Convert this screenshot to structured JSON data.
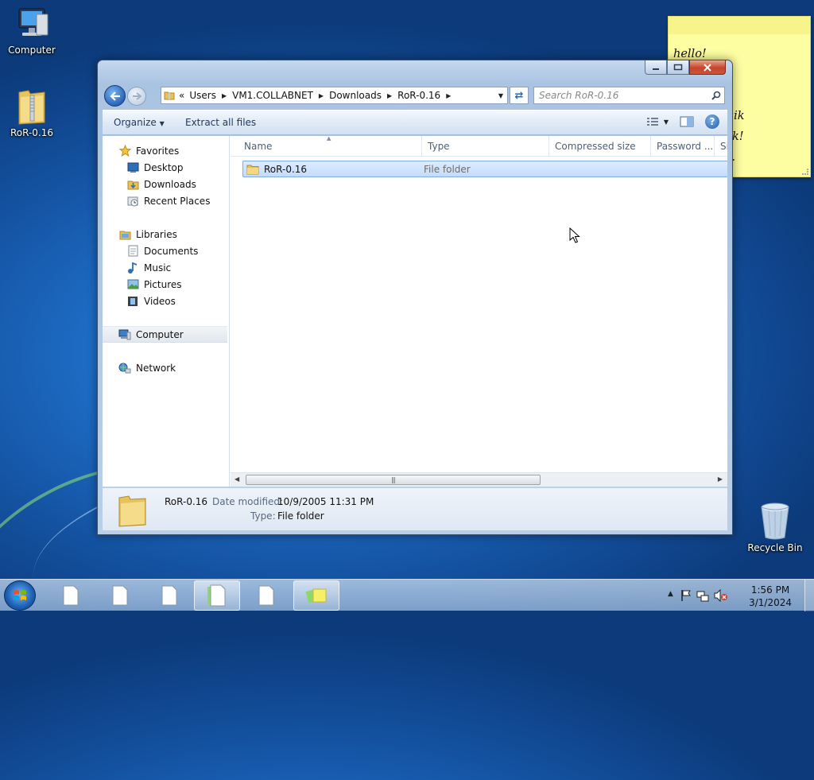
{
  "desktop": {
    "icons": [
      {
        "label": "Computer"
      },
      {
        "label": "RoR-0.16"
      },
      {
        "label": "Recycle Bin"
      }
    ],
    "sticky_note": {
      "text": "hello!\n destroyed\n out the\n works, afaik\n ed anydesk!\n nstalled it."
    }
  },
  "window": {
    "address": {
      "overflow": "«",
      "crumbs": [
        "Users",
        "VM1.COLLABNET",
        "Downloads",
        "RoR-0.16"
      ]
    },
    "search": {
      "placeholder": "Search RoR-0.16"
    },
    "toolbar": {
      "organize": "Organize",
      "extract": "Extract all files"
    },
    "sidebar": {
      "favorites": "Favorites",
      "desktop": "Desktop",
      "downloads": "Downloads",
      "recent": "Recent Places",
      "libraries": "Libraries",
      "documents": "Documents",
      "music": "Music",
      "pictures": "Pictures",
      "videos": "Videos",
      "computer": "Computer",
      "network": "Network"
    },
    "columns": {
      "name": "Name",
      "type": "Type",
      "size": "Compressed size",
      "password": "Password ...",
      "si": "Si"
    },
    "rows": [
      {
        "name": "RoR-0.16",
        "type": "File folder"
      }
    ],
    "details": {
      "name": "RoR-0.16",
      "modified_label": "Date modified:",
      "modified_value": "10/9/2005 11:31 PM",
      "type_label": "Type:",
      "type_value": "File folder"
    }
  },
  "taskbar": {
    "clock_time": "1:56 PM",
    "clock_date": "3/1/2024"
  },
  "colors": {
    "accent": "#2a65b8",
    "selection": "#c2dcfd",
    "sticky": "#fdfda2"
  }
}
